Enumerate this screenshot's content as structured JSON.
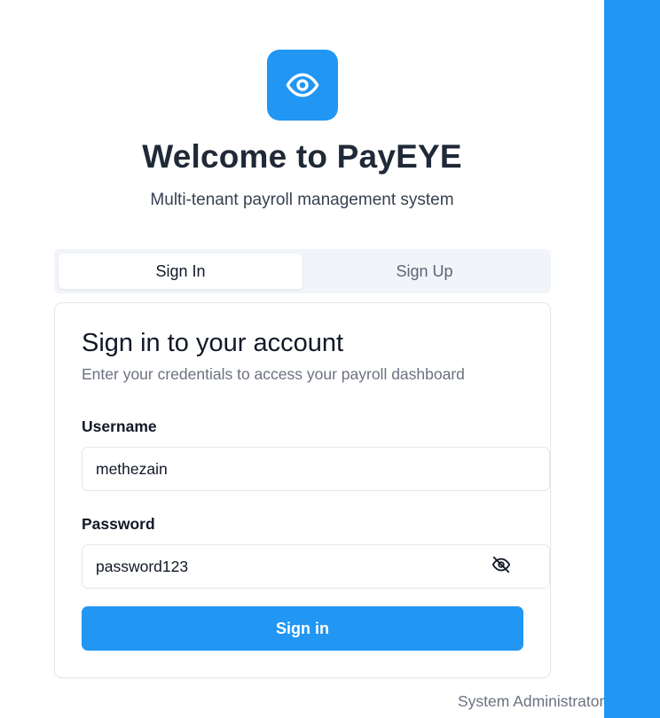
{
  "brand": {
    "logo_icon": "eye-icon",
    "accent_color": "#2196f3"
  },
  "header": {
    "title": "Welcome to PayEYE",
    "subtitle": "Multi-tenant payroll management system"
  },
  "tabs": [
    {
      "label": "Sign In",
      "active": true
    },
    {
      "label": "Sign Up",
      "active": false
    }
  ],
  "card": {
    "title": "Sign in to your account",
    "description": "Enter your credentials to access your payroll dashboard",
    "username": {
      "label": "Username",
      "value": "methezain"
    },
    "password": {
      "label": "Password",
      "value": "password123",
      "toggle_icon": "eye-off-icon"
    },
    "submit_label": "Sign in"
  },
  "footer": {
    "role": "System Administrator"
  }
}
